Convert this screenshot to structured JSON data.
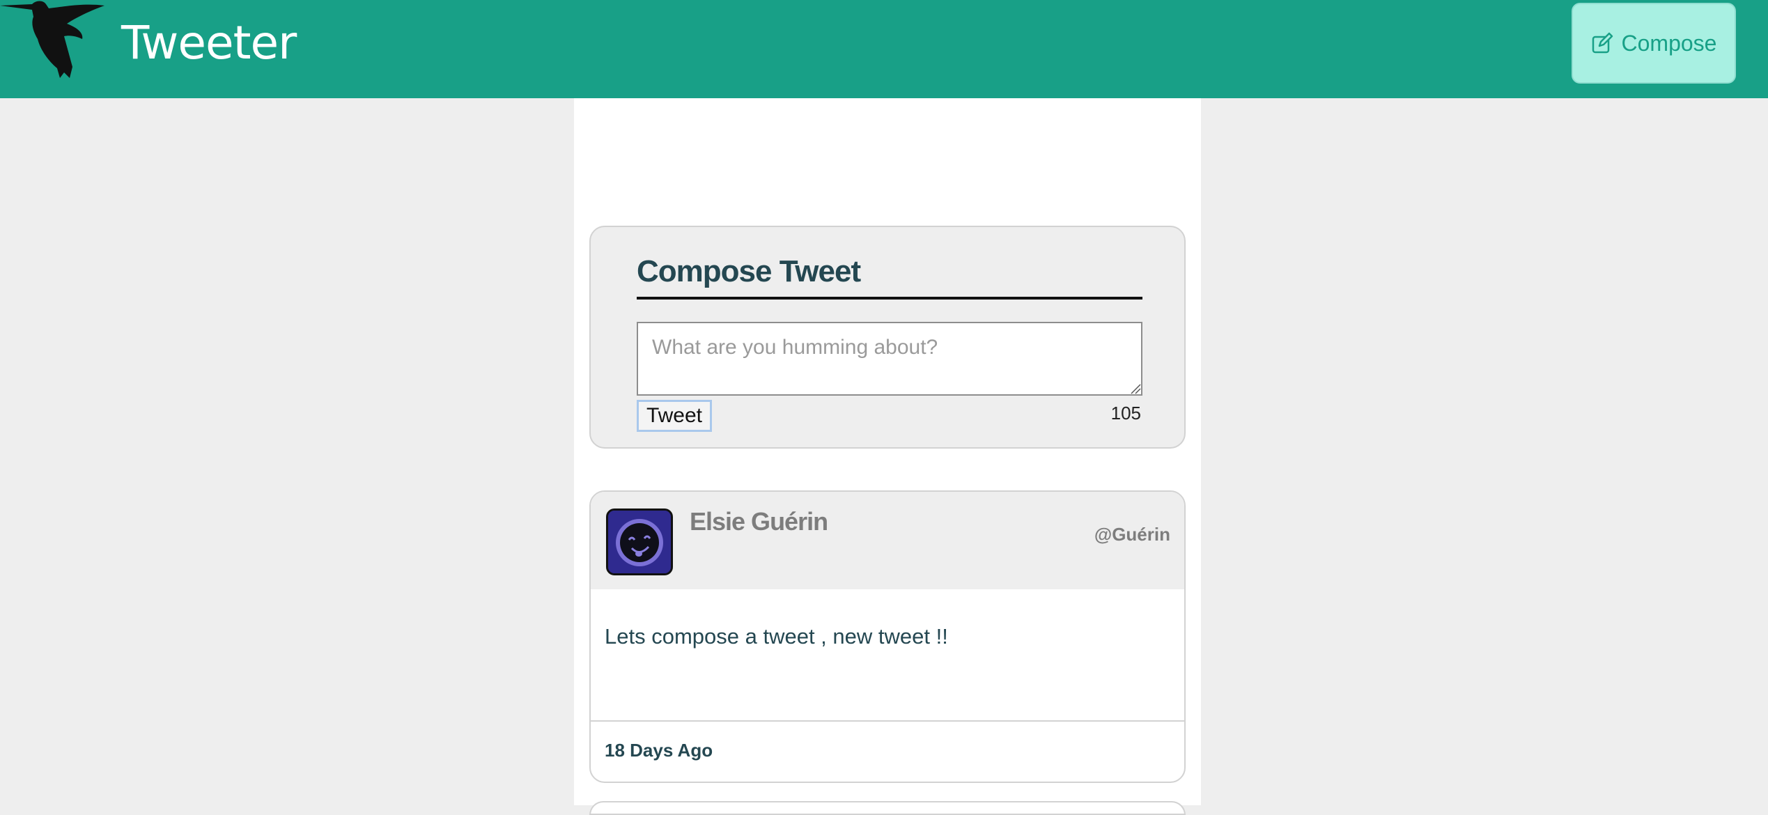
{
  "header": {
    "brand": "Tweeter",
    "compose_label": "Compose",
    "logo_icon": "hummingbird-icon",
    "compose_icon": "edit-icon",
    "bg_color": "#18a087",
    "compose_bg": "#a8f0e2"
  },
  "compose": {
    "title": "Compose Tweet",
    "placeholder": "What are you humming about?",
    "value": "",
    "submit_label": "Tweet",
    "char_count": "105"
  },
  "tweets": [
    {
      "author": "Elsie Guérin",
      "handle": "@Guérin",
      "avatar_icon": "smiley-avatar-icon",
      "text": "Lets compose a tweet , new tweet !!",
      "time": "18 Days Ago"
    }
  ]
}
